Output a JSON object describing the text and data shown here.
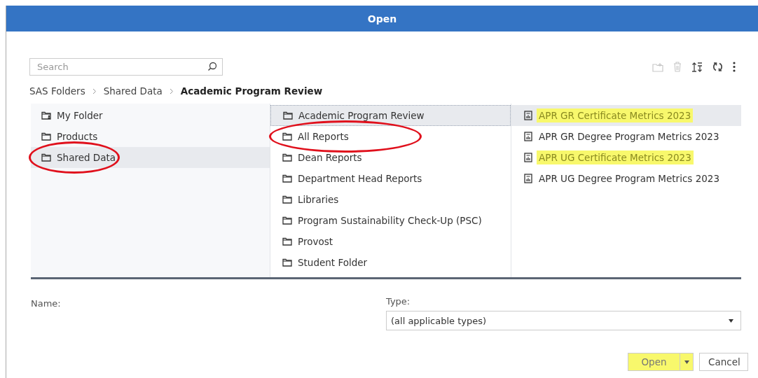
{
  "window": {
    "title": "Open"
  },
  "search": {
    "placeholder": "Search"
  },
  "toolbar": [
    {
      "kind": "new-folder",
      "disabled": true
    },
    {
      "kind": "delete",
      "disabled": true
    },
    {
      "kind": "sort",
      "disabled": false
    },
    {
      "kind": "refresh",
      "disabled": false
    },
    {
      "kind": "more",
      "disabled": false
    }
  ],
  "breadcrumb": [
    {
      "label": "SAS Folders",
      "current": false
    },
    {
      "label": "Shared Data",
      "current": false
    },
    {
      "label": "Academic Program Review",
      "current": true
    }
  ],
  "columns": [
    {
      "items": [
        {
          "kind": "home-folder",
          "label": "My Folder",
          "selected": false,
          "circled": false,
          "highlighted": false
        },
        {
          "kind": "folder",
          "label": "Products",
          "selected": false,
          "circled": false,
          "highlighted": false
        },
        {
          "kind": "folder",
          "label": "Shared Data",
          "selected": true,
          "circled": true,
          "highlighted": false
        }
      ]
    },
    {
      "items": [
        {
          "kind": "folder",
          "label": "Academic Program Review",
          "selected": true,
          "circled": false,
          "highlighted": false
        },
        {
          "kind": "folder",
          "label": "All Reports",
          "selected": false,
          "circled": true,
          "highlighted": false
        },
        {
          "kind": "folder",
          "label": "Dean Reports",
          "selected": false,
          "circled": false,
          "highlighted": false
        },
        {
          "kind": "folder",
          "label": "Department Head Reports",
          "selected": false,
          "circled": false,
          "highlighted": false
        },
        {
          "kind": "folder",
          "label": "Libraries",
          "selected": false,
          "circled": false,
          "highlighted": false
        },
        {
          "kind": "folder",
          "label": "Program Sustainability Check-Up (PSC)",
          "selected": false,
          "circled": false,
          "highlighted": false
        },
        {
          "kind": "folder",
          "label": "Provost",
          "selected": false,
          "circled": false,
          "highlighted": false
        },
        {
          "kind": "folder",
          "label": "Student Folder",
          "selected": false,
          "circled": false,
          "highlighted": false
        }
      ]
    },
    {
      "items": [
        {
          "kind": "report",
          "label": "APR GR Certificate Metrics 2023",
          "selected": true,
          "circled": false,
          "highlighted": true
        },
        {
          "kind": "report",
          "label": "APR GR Degree Program Metrics 2023",
          "selected": false,
          "circled": false,
          "highlighted": false
        },
        {
          "kind": "report",
          "label": "APR UG Certificate Metrics 2023",
          "selected": false,
          "circled": false,
          "highlighted": true
        },
        {
          "kind": "report",
          "label": "APR UG Degree Program Metrics 2023",
          "selected": false,
          "circled": false,
          "highlighted": false
        }
      ]
    }
  ],
  "name_field": {
    "label": "Name:"
  },
  "type_field": {
    "label": "Type:",
    "value": "(all applicable types)"
  },
  "buttons": {
    "open": {
      "label": "Open",
      "highlighted": true
    },
    "cancel": {
      "label": "Cancel"
    }
  }
}
